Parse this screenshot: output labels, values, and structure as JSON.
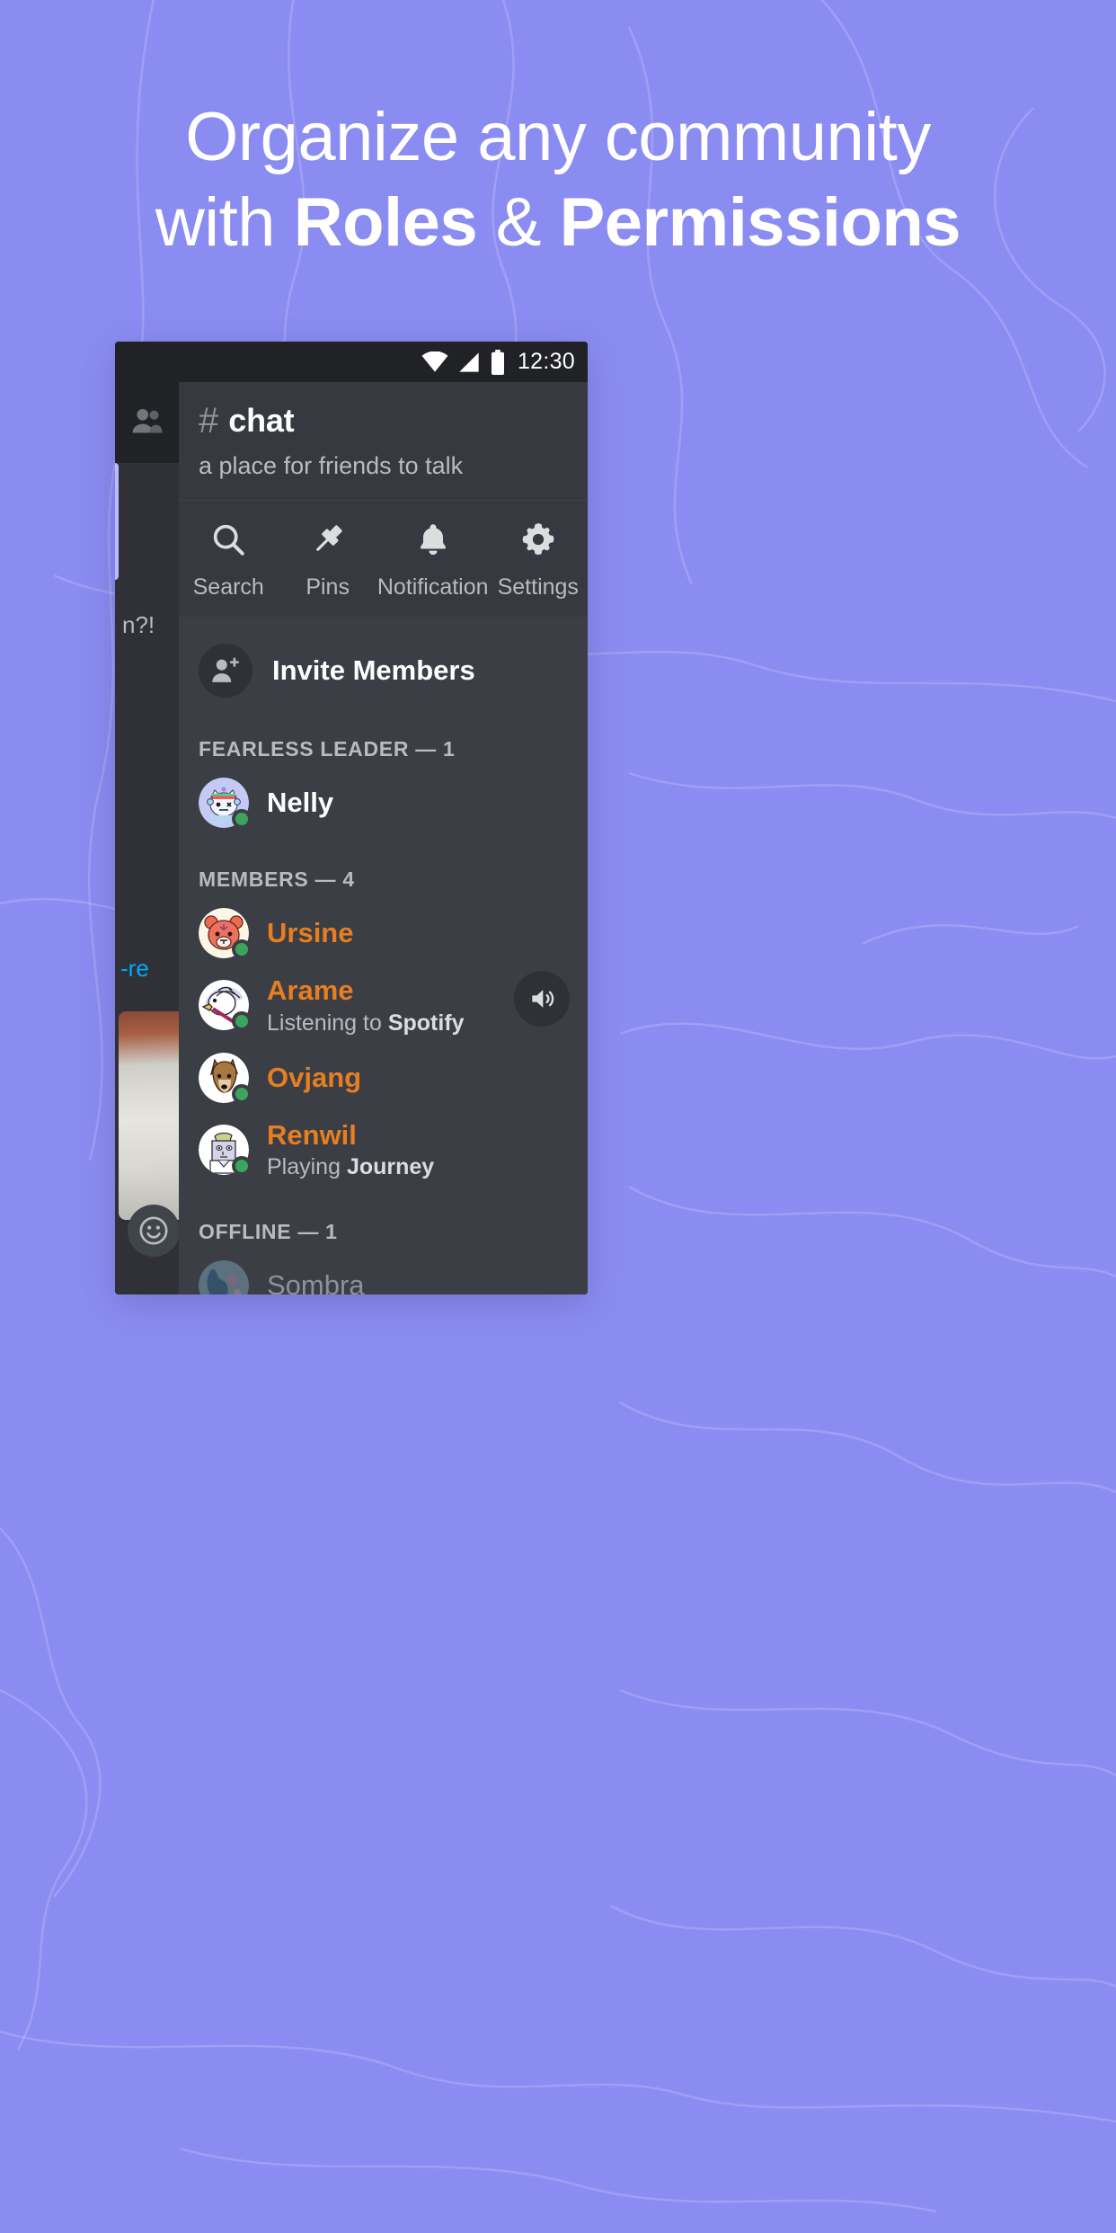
{
  "theme": {
    "background": "#8b8cf2",
    "headline_color": "#ffffff",
    "app_bg": "#36393f",
    "member_pane_bg": "#3b3e45",
    "role_member_color": "#e67e22",
    "online_color": "#3ba55d",
    "muted_text": "#b9bbbe"
  },
  "headline": {
    "line1": "Organize any community",
    "line2_prefix": "with ",
    "line2_bold1": "Roles",
    "line2_mid": " & ",
    "line2_bold2": "Permissions"
  },
  "statusbar": {
    "wifi_icon": "wifi-icon",
    "signal_icon": "cellular-signal-icon",
    "battery_icon": "battery-full-icon",
    "clock": "12:30"
  },
  "left_panel": {
    "members_icon": "people-icon",
    "snippet_top": "n?!",
    "snippet_link": "-re",
    "emoji_icon": "emoji-smiley-icon",
    "image_thumb": "image-attachment"
  },
  "channel": {
    "hash_icon": "hash-icon",
    "name": "chat",
    "topic": "a place for friends to talk"
  },
  "actions": [
    {
      "icon": "search-icon",
      "label": "Search"
    },
    {
      "icon": "pin-icon",
      "label": "Pins"
    },
    {
      "icon": "bell-icon",
      "label": "Notification"
    },
    {
      "icon": "gear-icon",
      "label": "Settings"
    }
  ],
  "invite": {
    "icon": "person-add-icon",
    "label": "Invite Members"
  },
  "groups": [
    {
      "header": "FEARLESS LEADER — 1",
      "members": [
        {
          "name": "Nelly",
          "name_color": "#ffffff",
          "status": "online",
          "activity_prefix": "",
          "activity_bold": "",
          "avatar": "cat-wumpus-avatar",
          "has_speaker": false
        }
      ]
    },
    {
      "header": "MEMBERS — 4",
      "members": [
        {
          "name": "Ursine",
          "name_color": "#e67e22",
          "status": "online",
          "activity_prefix": "",
          "activity_bold": "",
          "avatar": "bear-avatar",
          "has_speaker": false
        },
        {
          "name": "Arame",
          "name_color": "#e67e22",
          "status": "online",
          "activity_prefix": "Listening to ",
          "activity_bold": "Spotify",
          "avatar": "duck-avatar",
          "has_speaker": true,
          "speaker_icon": "speaker-icon"
        },
        {
          "name": "Ovjang",
          "name_color": "#e67e22",
          "status": "online",
          "activity_prefix": "",
          "activity_bold": "",
          "avatar": "dog-avatar",
          "has_speaker": false
        },
        {
          "name": "Renwil",
          "name_color": "#e67e22",
          "status": "online",
          "activity_prefix": "Playing ",
          "activity_bold": "Journey",
          "avatar": "statue-avatar",
          "has_speaker": false
        }
      ]
    },
    {
      "header": "OFFLINE — 1",
      "members": [
        {
          "name": "Sombra",
          "name_color": "#8e9297",
          "status": "offline",
          "activity_prefix": "",
          "activity_bold": "",
          "avatar": "globe-avatar",
          "has_speaker": false
        }
      ]
    }
  ]
}
